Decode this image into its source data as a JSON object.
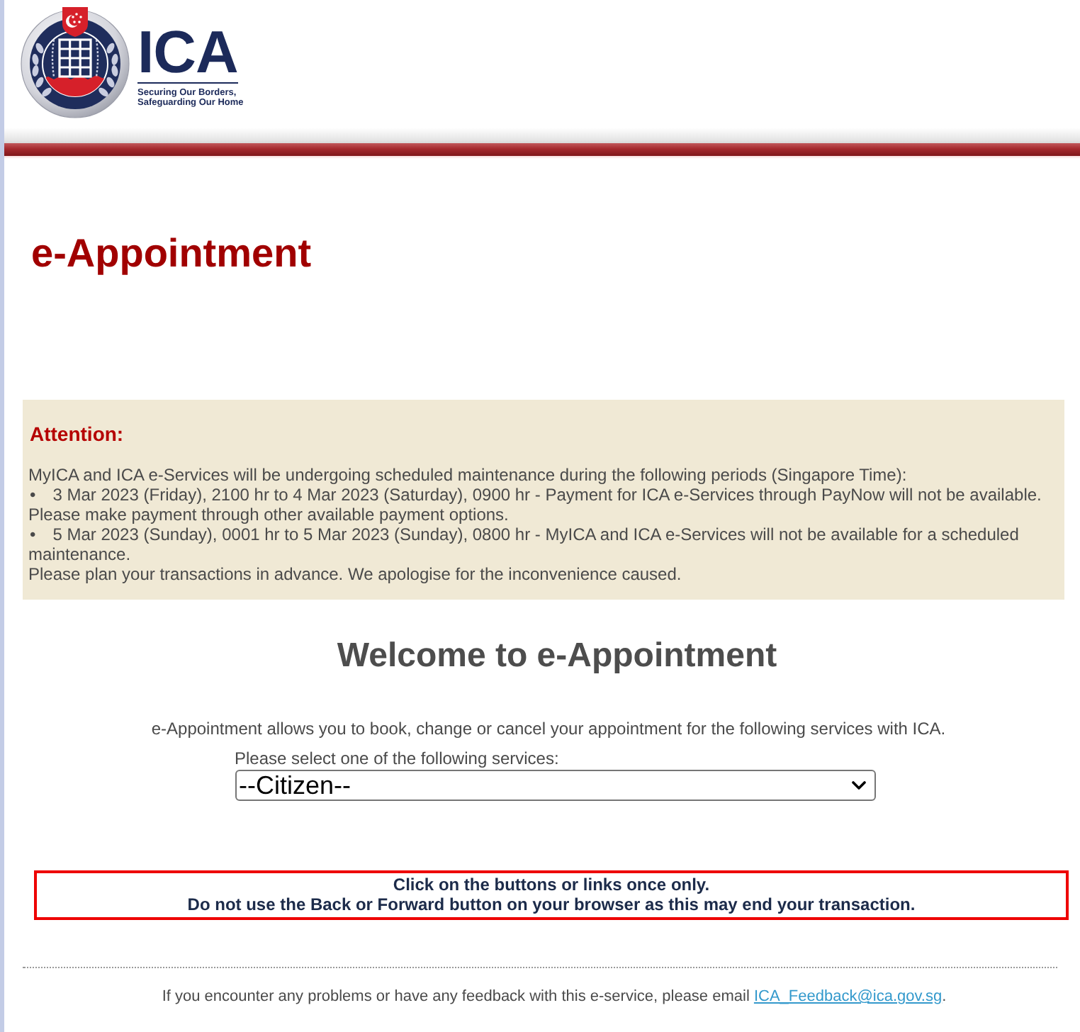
{
  "header": {
    "logo_text": "ICA",
    "tagline": [
      "Securing Our Borders,",
      "Safeguarding Our Home"
    ]
  },
  "page_title": "e-Appointment",
  "notice": {
    "heading": "Attention:",
    "paragraphs": [
      {
        "kind": "text",
        "text": "MyICA and ICA e-Services will be undergoing scheduled maintenance during the following periods (Singapore Time):"
      },
      {
        "kind": "bullet",
        "marker": "•",
        "text": "3 Mar 2023 (Friday), 2100 hr to 4 Mar 2023 (Saturday), 0900 hr - Payment for ICA e-Services through PayNow will not be available. Please make payment through other available payment options."
      },
      {
        "kind": "bullet",
        "marker": "•",
        "text": "5 Mar 2023 (Sunday), 0001 hr to 5 Mar 2023 (Sunday), 0800 hr - MyICA and ICA e-Services will not be available for a scheduled maintenance."
      },
      {
        "kind": "text",
        "text": "Please plan your transactions in advance. We apologise for the inconvenience caused."
      }
    ]
  },
  "welcome": {
    "heading": "Welcome to e-Appointment",
    "intro": "e-Appointment allows you to book, change or cancel your appointment for the following services with ICA."
  },
  "service_select": {
    "label": "Please select one of the following services:",
    "value": "--Citizen--"
  },
  "warning": {
    "lines": [
      "Click on the buttons or links once only.",
      "Do not use the Back or Forward button on your browser as this may end your transaction."
    ]
  },
  "footer": {
    "text": "If you encounter any problems or have any feedback with this e-service, please email",
    "link": "ICA_Feedback@ica.gov.sg",
    "end": "."
  }
}
